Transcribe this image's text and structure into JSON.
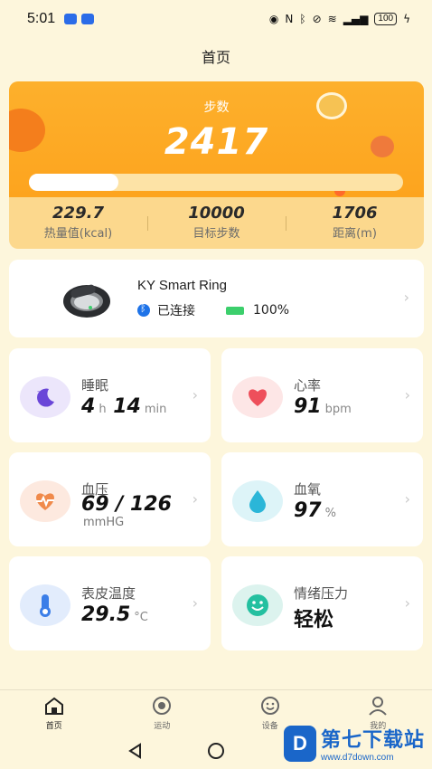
{
  "status_bar": {
    "time": "5:01",
    "battery": "100"
  },
  "header": {
    "title": "首页"
  },
  "steps": {
    "label": "步数",
    "value": "2417",
    "progress_fraction": 0.24,
    "stats": [
      {
        "value": "229.7",
        "label": "热量值(kcal)"
      },
      {
        "value": "10000",
        "label": "目标步数"
      },
      {
        "value": "1706",
        "label": "距离(m)"
      }
    ]
  },
  "device": {
    "name": "KY Smart Ring",
    "status": "已连接",
    "battery": "100%"
  },
  "tiles": {
    "sleep": {
      "title": "睡眠",
      "hours": "4",
      "h_unit": "h",
      "minutes": "14",
      "min_unit": "min"
    },
    "heart": {
      "title": "心率",
      "value": "91",
      "unit": "bpm"
    },
    "blood_pressure": {
      "title": "血压",
      "value": "69 / 126",
      "unit": "mmHG"
    },
    "oxygen": {
      "title": "血氧",
      "value": "97",
      "unit": "%"
    },
    "skin_temp": {
      "title": "表皮温度",
      "value": "29.5",
      "unit": "°C"
    },
    "stress": {
      "title": "情绪压力",
      "value": "轻松"
    }
  },
  "nav": {
    "items": [
      {
        "label": "首页",
        "icon": "home-icon"
      },
      {
        "label": "运动",
        "icon": "sport-icon"
      },
      {
        "label": "设备",
        "icon": "device-icon"
      },
      {
        "label": "我的",
        "icon": "profile-icon"
      }
    ]
  },
  "watermark": {
    "logo": "D",
    "title": "第七下载站",
    "url": "www.d7down.com"
  },
  "colors": {
    "background": "#fdf6dc",
    "steps_orange": "#fda41e",
    "sleep_icon_bg": "#ece6fb",
    "heart_icon_bg": "#fde6e6",
    "bp_icon_bg": "#fde9df",
    "oxygen_icon_bg": "#ddf4f8",
    "temp_icon_bg": "#e2ecfc",
    "stress_icon_bg": "#dcf3ee"
  }
}
